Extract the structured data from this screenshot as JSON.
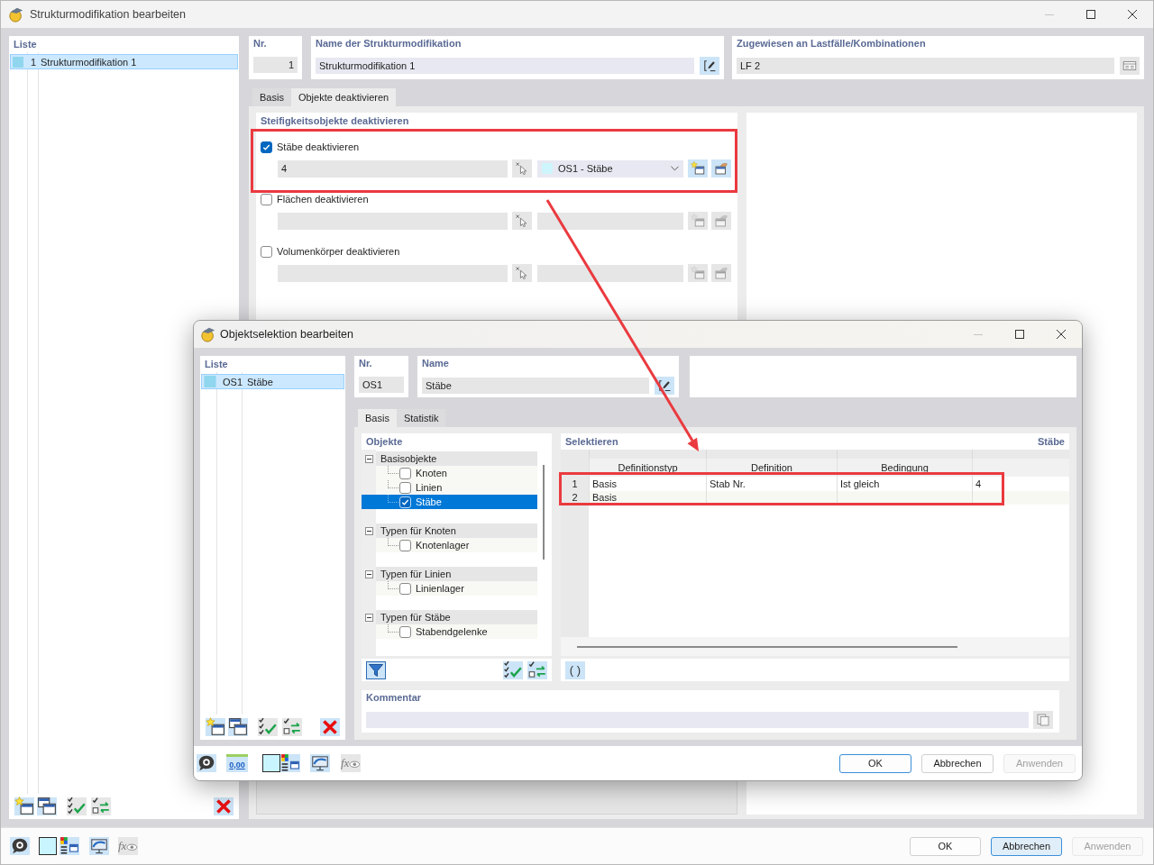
{
  "window": {
    "title": "Strukturmodifikation bearbeiten"
  },
  "list_panel": {
    "title": "Liste",
    "items": [
      {
        "number": "1",
        "name": "Strukturmodifikation 1",
        "selected": true
      }
    ],
    "toolbar": [
      {
        "kind": "new",
        "disabled": false
      },
      {
        "kind": "copy",
        "disabled": false
      },
      {
        "kind": "check-all",
        "disabled": true
      },
      {
        "kind": "check-swap",
        "disabled": true
      },
      {
        "kind": "delete",
        "disabled": false
      }
    ]
  },
  "nr": {
    "label": "Nr.",
    "value": "1"
  },
  "name": {
    "label": "Name der Strukturmodifikation",
    "value": "Strukturmodifikation 1"
  },
  "assigned": {
    "label": "Zugewiesen an Lastfälle/Kombinationen",
    "value": "LF 2"
  },
  "tabs": [
    {
      "label": "Basis",
      "selected": false
    },
    {
      "label": "Objekte deaktivieren",
      "selected": true
    }
  ],
  "deactivate_group": {
    "title": "Steifigkeitsobjekte deaktivieren",
    "rows": [
      {
        "label": "Stäbe deaktivieren",
        "checked": true,
        "value": "4",
        "selection": "OS1 - Stäbe"
      },
      {
        "label": "Flächen deaktivieren",
        "checked": false
      },
      {
        "label": "Volumenkörper deaktivieren",
        "checked": false
      }
    ]
  },
  "footer_tools": [
    {
      "kind": "help",
      "disabled": false
    },
    {
      "kind": "color"
    },
    {
      "kind": "text-color",
      "disabled": false
    },
    {
      "kind": "display",
      "disabled": false
    },
    {
      "kind": "formula",
      "label": "fx",
      "disabled": true
    }
  ],
  "buttons": [
    {
      "label": "OK",
      "focused": false,
      "hovered": false,
      "disabled": false
    },
    {
      "label": "Abbrechen",
      "focused": true,
      "hovered": true,
      "disabled": false
    },
    {
      "label": "Anwenden",
      "focused": false,
      "hovered": false,
      "disabled": true
    }
  ],
  "dialog": {
    "title": "Objektselektion bearbeiten",
    "list_panel": {
      "title": "Liste",
      "items": [
        {
          "number": "OS1",
          "name": "Stäbe",
          "selected": true
        }
      ],
      "toolbar": [
        {
          "kind": "new",
          "disabled": false
        },
        {
          "kind": "copy",
          "disabled": false
        },
        {
          "kind": "check-all",
          "disabled": true
        },
        {
          "kind": "check-swap",
          "disabled": true
        },
        {
          "kind": "delete",
          "disabled": false
        }
      ]
    },
    "nr": {
      "label": "Nr.",
      "value": "OS1"
    },
    "name": {
      "label": "Name",
      "value": "Stäbe"
    },
    "tabs": [
      {
        "label": "Basis",
        "selected": true
      },
      {
        "label": "Statistik",
        "selected": false
      }
    ],
    "objects": {
      "title": "Objekte",
      "tree": [
        {
          "label": "Basisobjekte",
          "expanded": true,
          "selected": false,
          "children": [
            {
              "label": "Knoten",
              "checked": false,
              "selected": false
            },
            {
              "label": "Linien",
              "checked": false,
              "selected": false
            },
            {
              "label": "Stäbe",
              "checked": true,
              "selected": true
            }
          ]
        },
        {
          "label": "Typen für Knoten",
          "expanded": true,
          "selected": false,
          "children": [
            {
              "label": "Knotenlager",
              "checked": false,
              "selected": false
            }
          ]
        },
        {
          "label": "Typen für Linien",
          "expanded": true,
          "selected": false,
          "children": [
            {
              "label": "Linienlager",
              "checked": false,
              "selected": false
            }
          ]
        },
        {
          "label": "Typen für Stäbe",
          "expanded": true,
          "selected": false,
          "children": [
            {
              "label": "Stabendgelenke",
              "checked": false,
              "selected": false
            }
          ]
        }
      ],
      "toolbar": [
        {
          "kind": "filter",
          "on": true,
          "disabled": false
        },
        {
          "kind": "check-all",
          "on": false,
          "disabled": false
        },
        {
          "kind": "check-swap",
          "on": false,
          "disabled": false
        }
      ]
    },
    "selection": {
      "title": "Selektieren",
      "object_type": "Stäbe",
      "columns": [
        "Definitionstyp",
        "Definition",
        "Bedingung"
      ],
      "rows": [
        {
          "number": "1",
          "cells": [
            "Basis",
            "Stab Nr.",
            "Ist gleich",
            "4"
          ]
        },
        {
          "number": "2",
          "cells": [
            "Basis"
          ]
        }
      ],
      "toolbar": [
        {
          "kind": "brackets",
          "label": "( )",
          "disabled": false
        }
      ]
    },
    "comment": {
      "label": "Kommentar"
    },
    "footer_tools": [
      {
        "kind": "help",
        "disabled": false
      },
      {
        "kind": "decimals",
        "label": "0,00",
        "disabled": false
      },
      {
        "kind": "color"
      },
      {
        "kind": "text-color",
        "disabled": false
      },
      {
        "kind": "display",
        "disabled": false
      },
      {
        "kind": "formula",
        "label": "fx",
        "disabled": true
      }
    ],
    "buttons": [
      {
        "label": "OK",
        "focused": true,
        "hovered": false,
        "disabled": false
      },
      {
        "label": "Abbrechen",
        "focused": false,
        "hovered": false,
        "disabled": false
      },
      {
        "label": "Anwenden",
        "focused": false,
        "hovered": false,
        "disabled": true
      }
    ]
  }
}
